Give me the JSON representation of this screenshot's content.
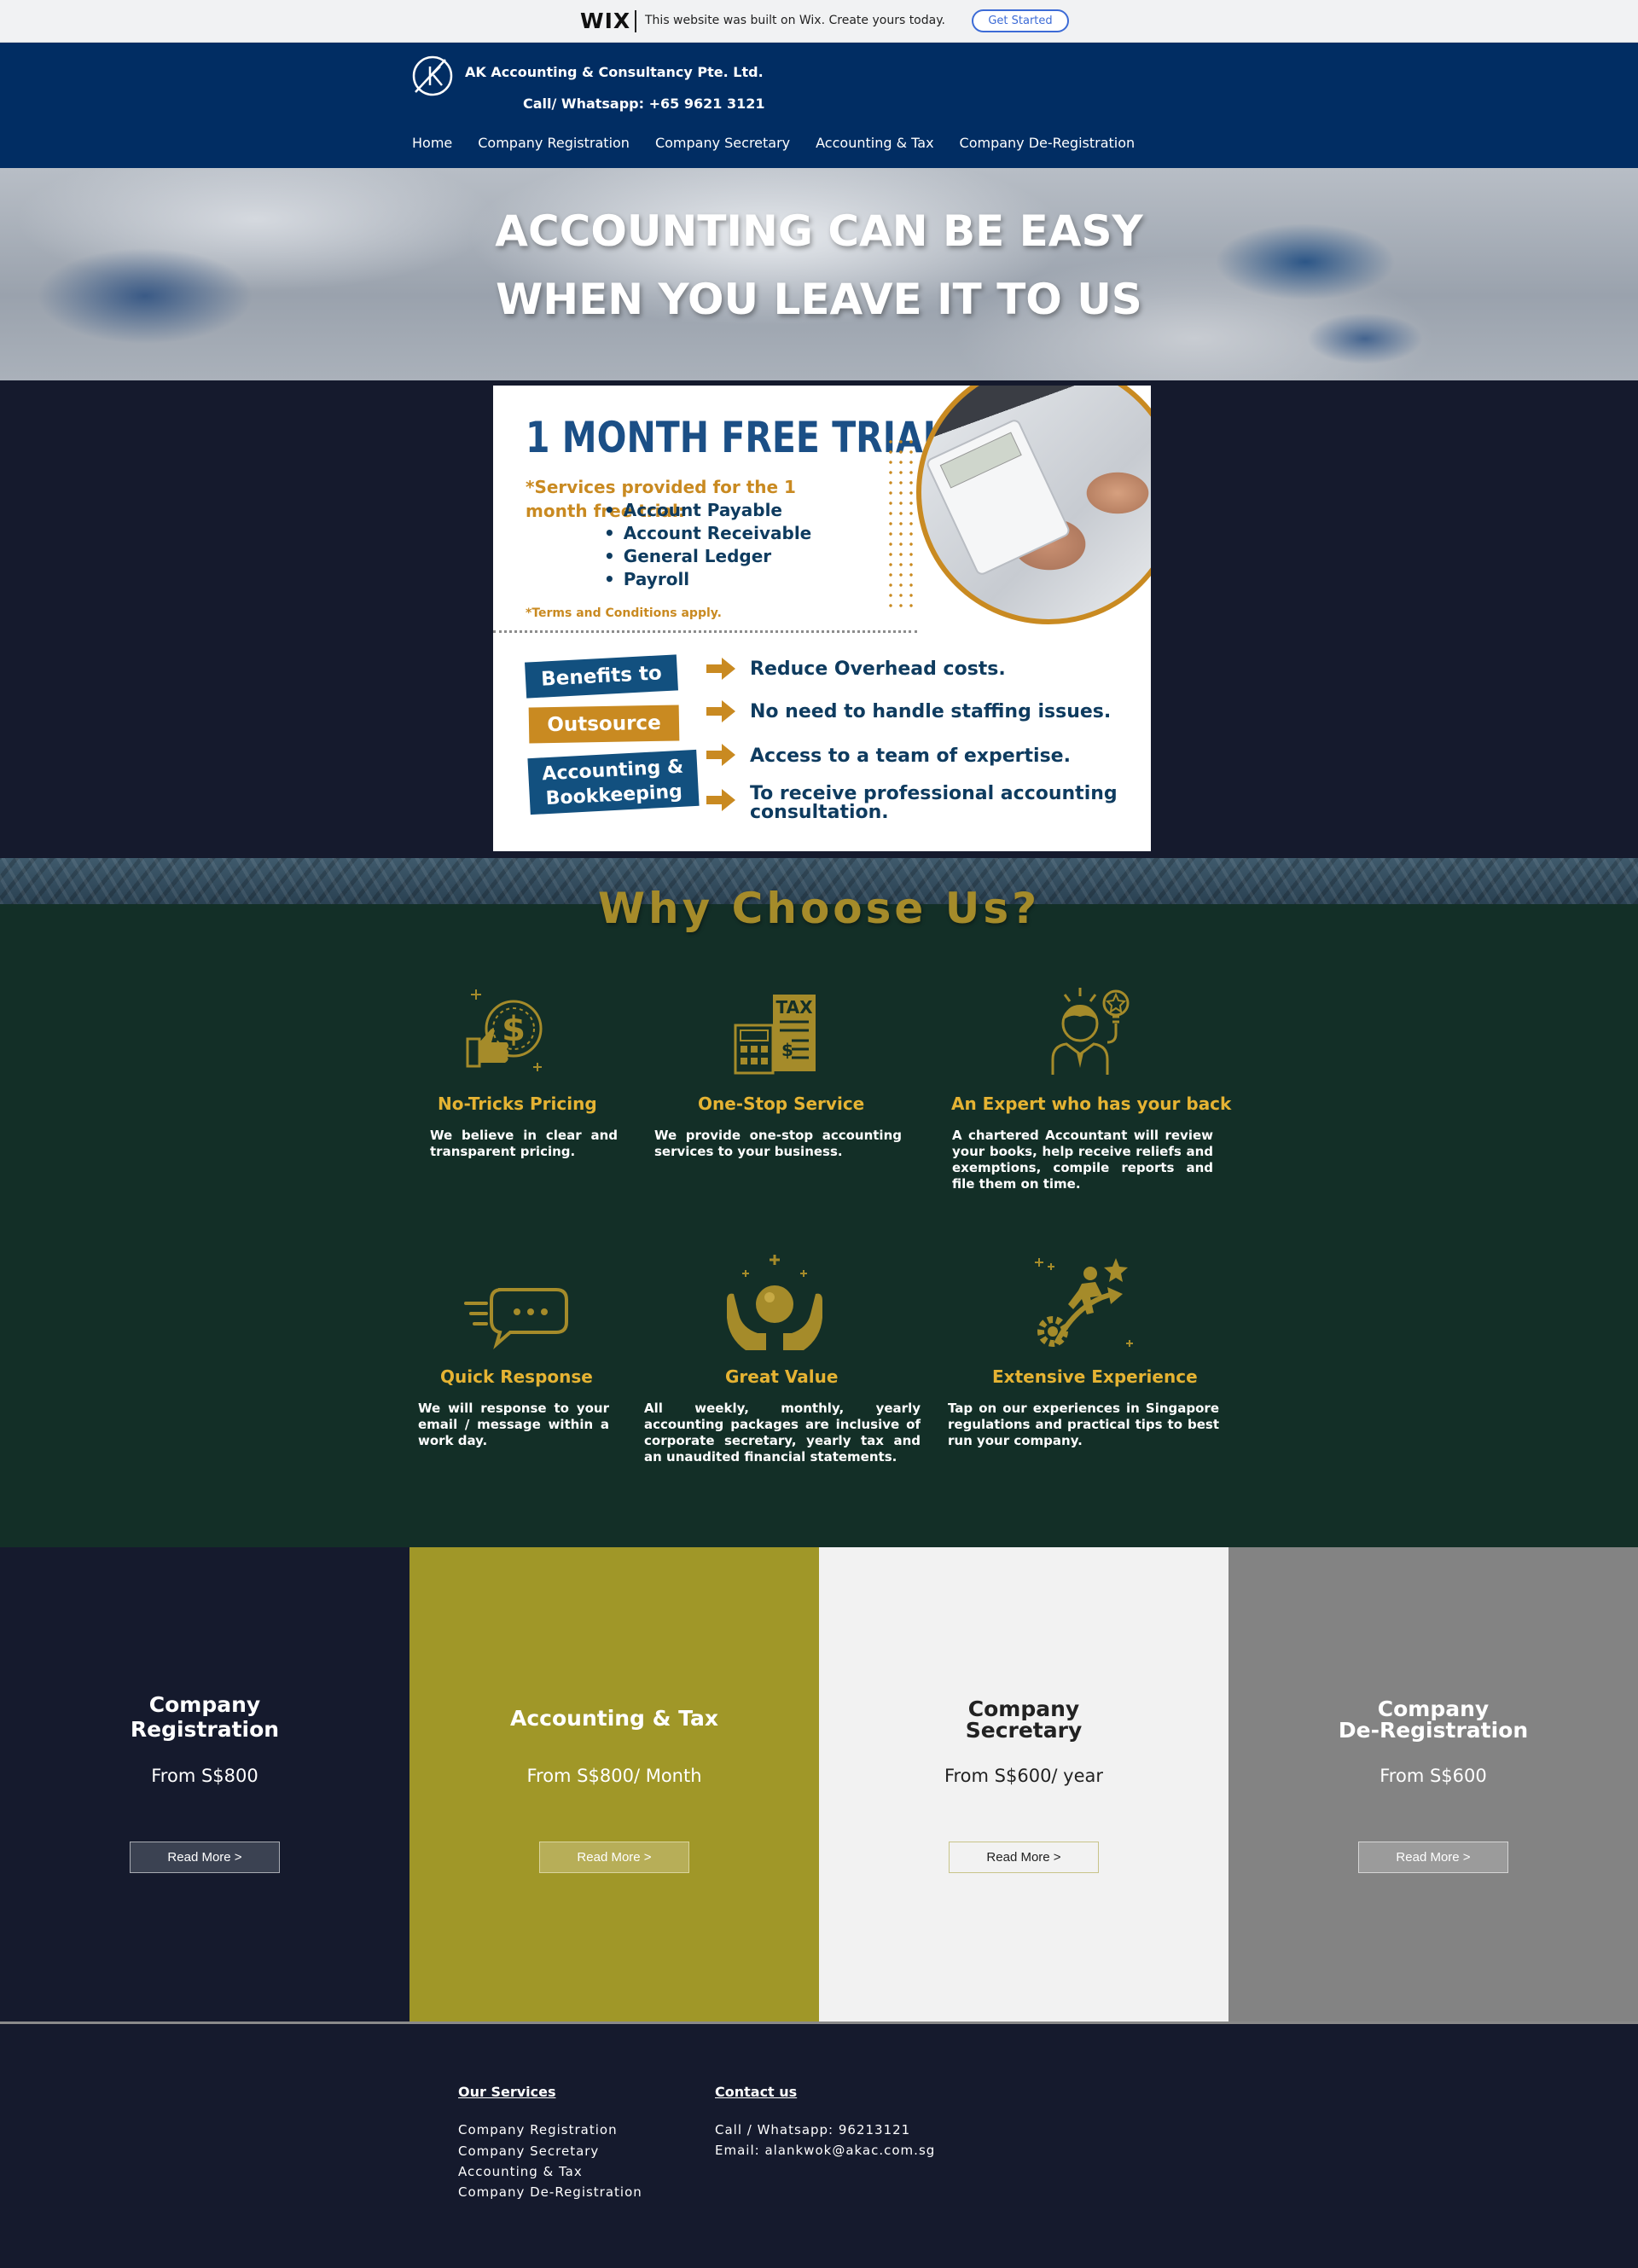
{
  "wix_banner": {
    "logo": "WIX",
    "text": "This website was built on Wix. Create yours today.",
    "cta": "Get Started"
  },
  "header": {
    "company_name": "AK Accounting & Consultancy Pte. Ltd.",
    "phone": "Call/ Whatsapp: +65 9621 3121",
    "nav": [
      "Home",
      "Company Registration",
      "Company Secretary",
      "Accounting & Tax",
      "Company De-Registration"
    ]
  },
  "hero": {
    "line1": "ACCOUNTING CAN BE EASY",
    "line2": "WHEN YOU LEAVE IT TO US"
  },
  "promo": {
    "title": "1 MONTH FREE TRIAL !",
    "services_intro": "*Services provided for the 1 month free trial:",
    "services": [
      "Account Payable",
      "Account Receivable",
      "General Ledger",
      "Payroll"
    ],
    "terms": "*Terms and Conditions apply.",
    "badges": [
      "Benefits to",
      "Outsource",
      "Accounting & Bookkeeping"
    ],
    "benefits": [
      "Reduce Overhead costs.",
      "No need to handle staffing issues.",
      "Access to a team of expertise.",
      "To receive professional accounting consultation."
    ]
  },
  "why": {
    "title": "Why Choose Us?",
    "features": [
      {
        "icon": "pricing-icon",
        "title": "No-Tricks Pricing",
        "desc": "We believe in clear and transparent pricing."
      },
      {
        "icon": "tax-icon",
        "title": "One-Stop Service",
        "desc": "We provide one-stop accounting services to your business."
      },
      {
        "icon": "expert-icon",
        "title": "An Expert who has your back",
        "desc": "A chartered Accountant will review your books, help receive reliefs and exemptions, compile reports and file them on time."
      },
      {
        "icon": "chat-icon",
        "title": "Quick Response",
        "desc": "We will response to your email / message within a work day."
      },
      {
        "icon": "value-icon",
        "title": "Great Value",
        "desc": "All weekly, monthly, yearly accounting packages are inclusive of corporate secretary, yearly tax and an unaudited financial statements."
      },
      {
        "icon": "experience-icon",
        "title": "Extensive Experience",
        "desc": "Tap on our experiences in Singapore regulations and practical tips to best run your company."
      }
    ]
  },
  "pricing": [
    {
      "title_1": "Company",
      "title_2": "Registration",
      "price": "From S$800",
      "button": "Read More >"
    },
    {
      "title_1": "Accounting & Tax",
      "title_2": "",
      "price": "From S$800/ Month",
      "button": "Read More >"
    },
    {
      "title_1": "Company",
      "title_2": "Secretary",
      "price": "From S$600/ year",
      "button": "Read More >"
    },
    {
      "title_1": "Company",
      "title_2": "De-Registration",
      "price": "From S$600",
      "button": "Read More >"
    }
  ],
  "footer": {
    "services_heading": "Our Services",
    "services": [
      "Company Registration",
      "Company Secretary",
      "Accounting & Tax",
      "Company De-Registration"
    ],
    "contact_heading": "Contact us",
    "contact_phone": "Call / Whatsapp: 96213121",
    "contact_email": "Email: alankwok@akac.com.sg"
  },
  "colors": {
    "header_blue": "#012d63",
    "navy": "#151a2d",
    "forest_green": "#132f27",
    "gold": "#e5b333",
    "olive": "#a09728",
    "promo_blue": "#1b4f86",
    "promo_gold": "#c98a21"
  }
}
